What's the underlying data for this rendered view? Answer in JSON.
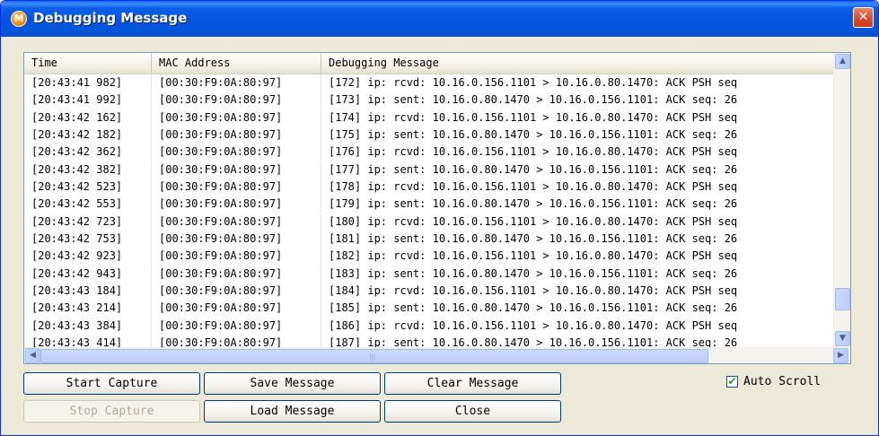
{
  "window": {
    "title": "Debugging Message",
    "close_glyph": "✕",
    "app_icon_letter": "M"
  },
  "columns": [
    "Time",
    "MAC Address",
    "Debugging Message"
  ],
  "rows": [
    {
      "time": "[20:43:41 982]",
      "mac": "[00:30:F9:0A:80:97]",
      "msg": "[172] ip: rcvd: 10.16.0.156.1101 > 10.16.0.80.1470: ACK PSH seq"
    },
    {
      "time": "[20:43:41 992]",
      "mac": "[00:30:F9:0A:80:97]",
      "msg": "[173] ip: sent: 10.16.0.80.1470 > 10.16.0.156.1101: ACK seq: 26"
    },
    {
      "time": "[20:43:42 162]",
      "mac": "[00:30:F9:0A:80:97]",
      "msg": "[174] ip: rcvd: 10.16.0.156.1101 > 10.16.0.80.1470: ACK PSH seq"
    },
    {
      "time": "[20:43:42 182]",
      "mac": "[00:30:F9:0A:80:97]",
      "msg": "[175] ip: sent: 10.16.0.80.1470 > 10.16.0.156.1101: ACK seq: 26"
    },
    {
      "time": "[20:43:42 362]",
      "mac": "[00:30:F9:0A:80:97]",
      "msg": "[176] ip: rcvd: 10.16.0.156.1101 > 10.16.0.80.1470: ACK PSH seq"
    },
    {
      "time": "[20:43:42 382]",
      "mac": "[00:30:F9:0A:80:97]",
      "msg": "[177] ip: sent: 10.16.0.80.1470 > 10.16.0.156.1101: ACK seq: 26"
    },
    {
      "time": "[20:43:42 523]",
      "mac": "[00:30:F9:0A:80:97]",
      "msg": "[178] ip: rcvd: 10.16.0.156.1101 > 10.16.0.80.1470: ACK PSH seq"
    },
    {
      "time": "[20:43:42 553]",
      "mac": "[00:30:F9:0A:80:97]",
      "msg": "[179] ip: sent: 10.16.0.80.1470 > 10.16.0.156.1101: ACK seq: 26"
    },
    {
      "time": "[20:43:42 723]",
      "mac": "[00:30:F9:0A:80:97]",
      "msg": "[180] ip: rcvd: 10.16.0.156.1101 > 10.16.0.80.1470: ACK PSH seq"
    },
    {
      "time": "[20:43:42 753]",
      "mac": "[00:30:F9:0A:80:97]",
      "msg": "[181] ip: sent: 10.16.0.80.1470 > 10.16.0.156.1101: ACK seq: 26"
    },
    {
      "time": "[20:43:42 923]",
      "mac": "[00:30:F9:0A:80:97]",
      "msg": "[182] ip: rcvd: 10.16.0.156.1101 > 10.16.0.80.1470: ACK PSH seq"
    },
    {
      "time": "[20:43:42 943]",
      "mac": "[00:30:F9:0A:80:97]",
      "msg": "[183] ip: sent: 10.16.0.80.1470 > 10.16.0.156.1101: ACK seq: 26"
    },
    {
      "time": "[20:43:43 184]",
      "mac": "[00:30:F9:0A:80:97]",
      "msg": "[184] ip: rcvd: 10.16.0.156.1101 > 10.16.0.80.1470: ACK PSH seq"
    },
    {
      "time": "[20:43:43 214]",
      "mac": "[00:30:F9:0A:80:97]",
      "msg": "[185] ip: sent: 10.16.0.80.1470 > 10.16.0.156.1101: ACK seq: 26"
    },
    {
      "time": "[20:43:43 384]",
      "mac": "[00:30:F9:0A:80:97]",
      "msg": "[186] ip: rcvd: 10.16.0.156.1101 > 10.16.0.80.1470: ACK PSH seq"
    },
    {
      "time": "[20:43:43 414]",
      "mac": "[00:30:F9:0A:80:97]",
      "msg": "[187] ip: sent: 10.16.0.80.1470 > 10.16.0.156.1101: ACK seq: 26"
    }
  ],
  "scrollbar": {
    "up_glyph": "▲",
    "down_glyph": "▼",
    "left_glyph": "◀",
    "right_glyph": "▶",
    "grip_glyph": "|||"
  },
  "buttons": {
    "start_capture": "Start Capture",
    "save_message": "Save Message",
    "clear_message": "Clear Message",
    "stop_capture": "Stop Capture",
    "load_message": "Load Message",
    "close": "Close"
  },
  "auto_scroll": {
    "label": "Auto Scroll",
    "checked": true,
    "check_glyph": "✔"
  },
  "colors": {
    "titlebar": "#0454e0",
    "close_button": "#d9482b",
    "check_mark": "#21a121",
    "window_bg": "#ece9d8"
  }
}
